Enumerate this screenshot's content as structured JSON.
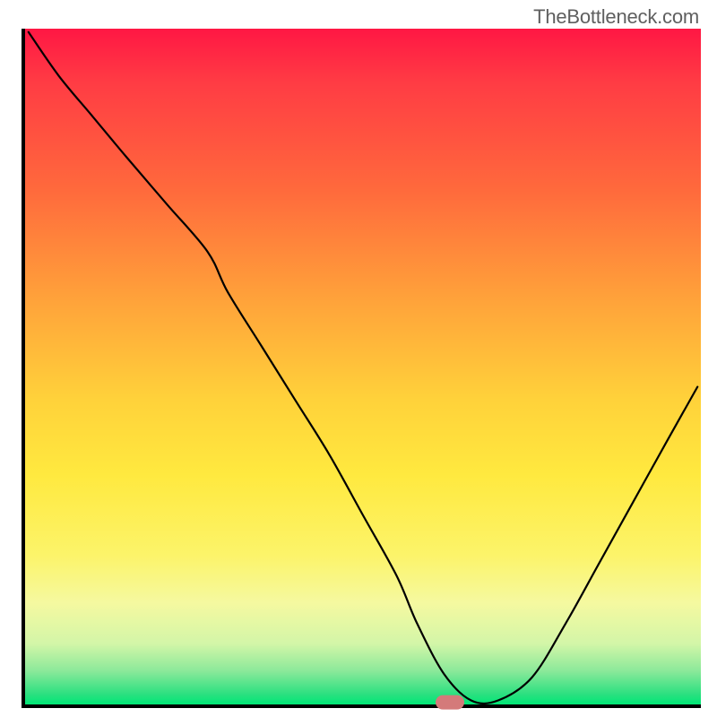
{
  "watermark": "TheBottleneck.com",
  "chart_data": {
    "type": "line",
    "title": "",
    "xlabel": "",
    "ylabel": "",
    "xlim": [
      0,
      100
    ],
    "ylim": [
      0,
      100
    ],
    "grid": false,
    "legend": false,
    "annotations": [],
    "axis_ticks_visible": false,
    "marker": {
      "x": 62.8,
      "y": 0,
      "shape": "rounded-rect",
      "color": "#d47a7a"
    },
    "series": [
      {
        "name": "bottleneck-curve",
        "color": "#000000",
        "x": [
          0.5,
          5,
          10,
          15,
          21,
          27,
          30,
          35,
          40,
          45,
          50,
          55,
          58,
          62,
          66,
          70,
          75,
          80,
          85,
          90,
          95,
          99.5
        ],
        "y": [
          99.5,
          93,
          87,
          81,
          74,
          67,
          61,
          53,
          45,
          37,
          28,
          19,
          12,
          4.5,
          0.6,
          0.6,
          4,
          12,
          21,
          30,
          39,
          47
        ]
      }
    ],
    "background_gradient": {
      "orientation": "vertical",
      "stops": [
        {
          "pos": 0,
          "color": "#ff1744"
        },
        {
          "pos": 0.08,
          "color": "#ff3c44"
        },
        {
          "pos": 0.24,
          "color": "#ff6a3c"
        },
        {
          "pos": 0.4,
          "color": "#ffa23a"
        },
        {
          "pos": 0.55,
          "color": "#ffd23a"
        },
        {
          "pos": 0.66,
          "color": "#ffe93f"
        },
        {
          "pos": 0.78,
          "color": "#fcf46a"
        },
        {
          "pos": 0.85,
          "color": "#f5f9a0"
        },
        {
          "pos": 0.91,
          "color": "#d3f6a8"
        },
        {
          "pos": 0.95,
          "color": "#8ce99a"
        },
        {
          "pos": 0.985,
          "color": "#2be080"
        },
        {
          "pos": 1.0,
          "color": "#00e676"
        }
      ]
    }
  }
}
